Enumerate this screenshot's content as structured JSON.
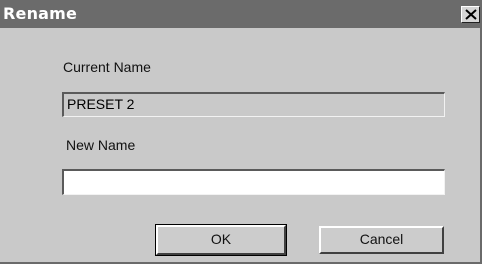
{
  "dialog": {
    "title": "Rename",
    "close_icon": "close-icon"
  },
  "current_name": {
    "label": "Current Name",
    "value": "PRESET 2"
  },
  "new_name": {
    "label": "New Name",
    "value": "",
    "placeholder": ""
  },
  "buttons": {
    "ok_label": "OK",
    "cancel_label": "Cancel"
  }
}
